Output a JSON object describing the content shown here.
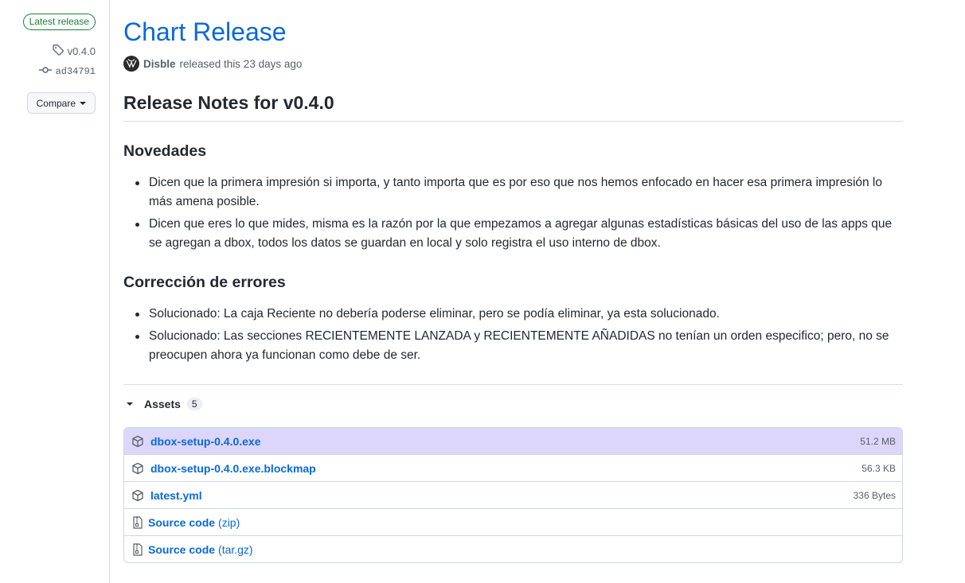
{
  "sidebar": {
    "latest_badge": "Latest release",
    "tag": "v0.4.0",
    "commit": "ad34791",
    "compare_label": "Compare"
  },
  "release": {
    "title": "Chart Release",
    "author": "Disble",
    "released_text": "released this 23 days ago"
  },
  "notes": {
    "heading": "Release Notes for v0.4.0",
    "sections": [
      {
        "title": "Novedades",
        "items": [
          "Dicen que la primera impresión si importa, y tanto importa que es por eso que nos hemos enfocado en hacer esa primera impresión lo más amena posible.",
          "Dicen que eres lo que mides, misma es la razón por la que empezamos a agregar algunas estadísticas básicas del uso de las apps que se agregan a dbox, todos los datos se guardan en local y solo registra el uso interno de dbox."
        ]
      },
      {
        "title": "Corrección de errores",
        "items": [
          "Solucionado: La caja Reciente no debería poderse eliminar, pero se podía eliminar, ya esta solucionado.",
          "Solucionado: Las secciones RECIENTEMENTE LANZADA y RECIENTEMENTE AÑADIDAS no tenían un orden especifico; pero, no se preocupen ahora ya funcionan como debe de ser."
        ]
      }
    ]
  },
  "assets": {
    "label": "Assets",
    "count": "5",
    "files": [
      {
        "name": "dbox-setup-0.4.0.exe",
        "size": "51.2 MB"
      },
      {
        "name": "dbox-setup-0.4.0.exe.blockmap",
        "size": "56.3 KB"
      },
      {
        "name": "latest.yml",
        "size": "336 Bytes"
      }
    ],
    "source": [
      {
        "name": "Source code",
        "format": "(zip)"
      },
      {
        "name": "Source code",
        "format": "(tar.gz)"
      }
    ]
  }
}
